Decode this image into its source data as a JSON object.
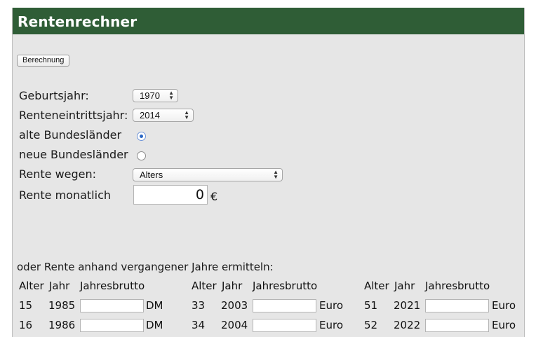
{
  "title": "Rentenrechner",
  "calc_button": "Berechnung",
  "form": {
    "geburtsjahr_label": "Geburtsjahr:",
    "geburtsjahr_value": "1970",
    "renteneintritt_label": "Renteneintrittsjahr:",
    "renteneintritt_value": "2014",
    "alte_label": "alte Bundesländer",
    "neue_label": "neue Bundesländer",
    "selected_region": "alte Bundesländer",
    "rente_wegen_label": "Rente wegen:",
    "rente_wegen_value": "Alters",
    "rente_monatlich_label": "Rente monatlich",
    "rente_monatlich_value": "0",
    "currency_symbol": "€"
  },
  "history": {
    "intro": "oder Rente anhand vergangener Jahre ermitteln:",
    "col_alter": "Alter",
    "col_jahr": "Jahr",
    "col_brutto": "Jahresbrutto",
    "groups": [
      {
        "rows": [
          {
            "alter": "15",
            "jahr": "1985",
            "unit": "DM"
          },
          {
            "alter": "16",
            "jahr": "1986",
            "unit": "DM"
          }
        ]
      },
      {
        "rows": [
          {
            "alter": "33",
            "jahr": "2003",
            "unit": "Euro"
          },
          {
            "alter": "34",
            "jahr": "2004",
            "unit": "Euro"
          }
        ]
      },
      {
        "rows": [
          {
            "alter": "51",
            "jahr": "2021",
            "unit": "Euro"
          },
          {
            "alter": "52",
            "jahr": "2022",
            "unit": "Euro"
          }
        ]
      }
    ]
  },
  "colors": {
    "header_bg": "#2f5d36",
    "panel_bg": "#e6e6e6",
    "radio_accent": "#2a66c4"
  }
}
